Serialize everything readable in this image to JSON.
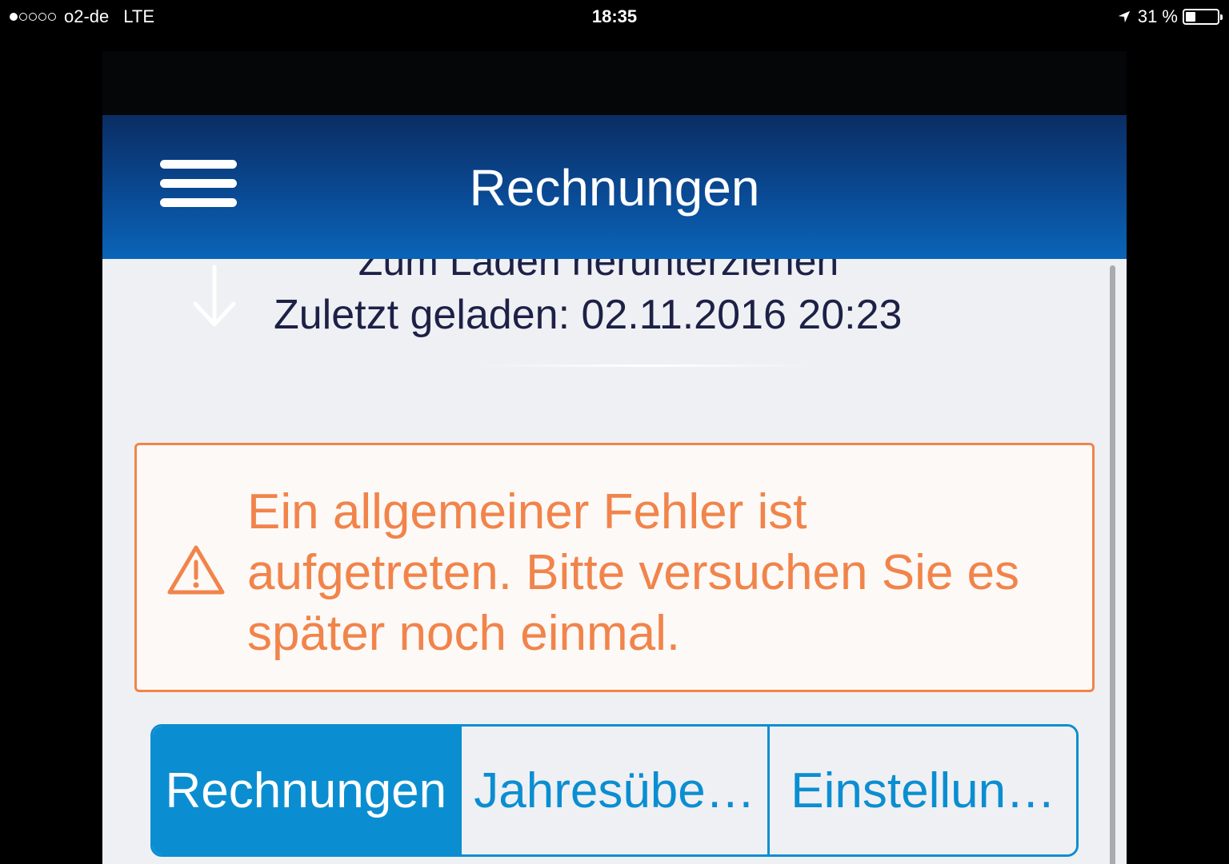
{
  "status_bar": {
    "carrier": "o2-de",
    "network": "LTE",
    "time": "18:35",
    "battery_percent": "31 %",
    "battery_level": 0.31,
    "icons": [
      "signal-dots-icon",
      "location-arrow-icon",
      "battery-icon"
    ]
  },
  "nav": {
    "title": "Rechnungen",
    "menu_icon": "hamburger-menu-icon"
  },
  "refresh": {
    "pull_label": "Zum Laden herunterziehen",
    "last_loaded": "Zuletzt geladen: 02.11.2016 20:23",
    "arrow_icon": "arrow-down-icon"
  },
  "error": {
    "message": "Ein allgemeiner Fehler ist aufgetreten. Bitte versuchen Sie es später noch einmal.",
    "icon": "warning-triangle-icon"
  },
  "segments": [
    {
      "label": "Rechnungen",
      "active": true
    },
    {
      "label": "Jahresübe…",
      "active": false
    },
    {
      "label": "Einstellun…",
      "active": false
    }
  ],
  "colors": {
    "nav_top": "#0a2d63",
    "nav_bottom": "#0a64b8",
    "error_accent": "#f1844b",
    "segment_accent": "#0b8ed1",
    "content_bg": "#eff0f4"
  }
}
